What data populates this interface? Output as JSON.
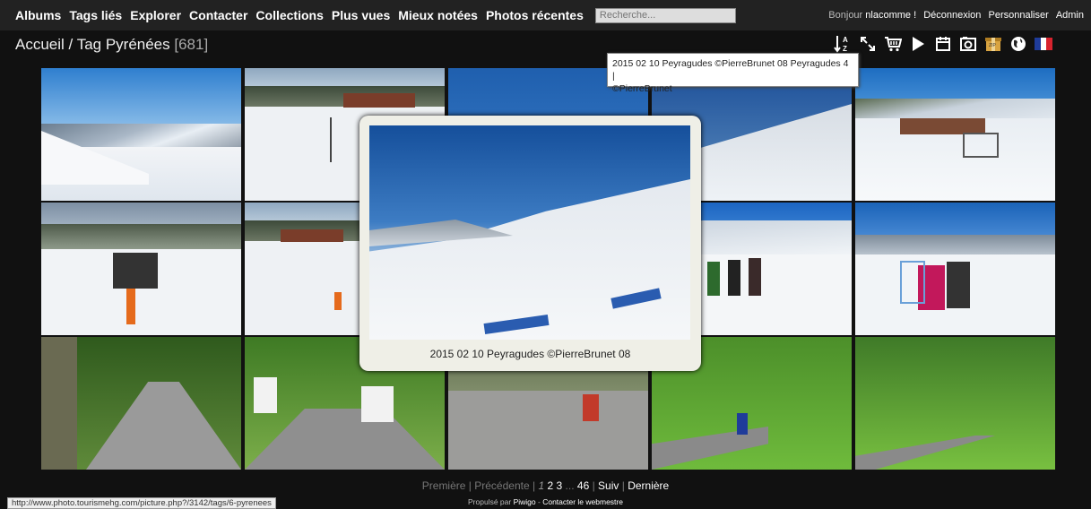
{
  "menu": {
    "items": [
      "Albums",
      "Tags liés",
      "Explorer",
      "Contacter",
      "Collections",
      "Plus vues",
      "Mieux notées",
      "Photos récentes"
    ],
    "search_placeholder": "Recherche..."
  },
  "usernav": {
    "greeting": "Bonjour",
    "username": "nlacomme !",
    "logout": "Déconnexion",
    "customize": "Personnaliser",
    "admin": "Admin"
  },
  "breadcrumb": {
    "home": "Accueil",
    "separator": " / ",
    "tag": "Tag Pyrénées",
    "count": "[681]"
  },
  "toolbar": {
    "icons": [
      "sort-az-icon",
      "fullscreen-icon",
      "cart-icon",
      "slideshow-play-icon",
      "calendar-icon",
      "camera-icon",
      "zip-download-icon",
      "globe-map-icon",
      "french-flag-icon"
    ]
  },
  "tooltip": {
    "line1": "2015 02 10 Peyragudes ©PierreBrunet 08 Peyragudes 4 |",
    "line2": "©PierreBrunet"
  },
  "overlay": {
    "caption": "2015 02 10 Peyragudes ©PierreBrunet 08"
  },
  "pagination": {
    "first": "Première",
    "prev": "Précédente",
    "current": "1",
    "pages": [
      "2",
      "3"
    ],
    "ellipsis": "...",
    "last_page": "46",
    "next": "Suiv",
    "last": "Dernière"
  },
  "footer": {
    "powered": "Propulsé par",
    "piwigo": "Piwigo",
    "dash": " - ",
    "contact": "Contacter le webmestre"
  },
  "statusbar": {
    "url": "http://www.photo.tourismehg.com/picture.php?/3142/tags/6-pyrenees"
  },
  "colors": {
    "background": "#111111",
    "menubar": "#222222",
    "overlay_bg": "#efefe7",
    "flag_blue": "#1f3c9a",
    "flag_red": "#d8232e"
  }
}
